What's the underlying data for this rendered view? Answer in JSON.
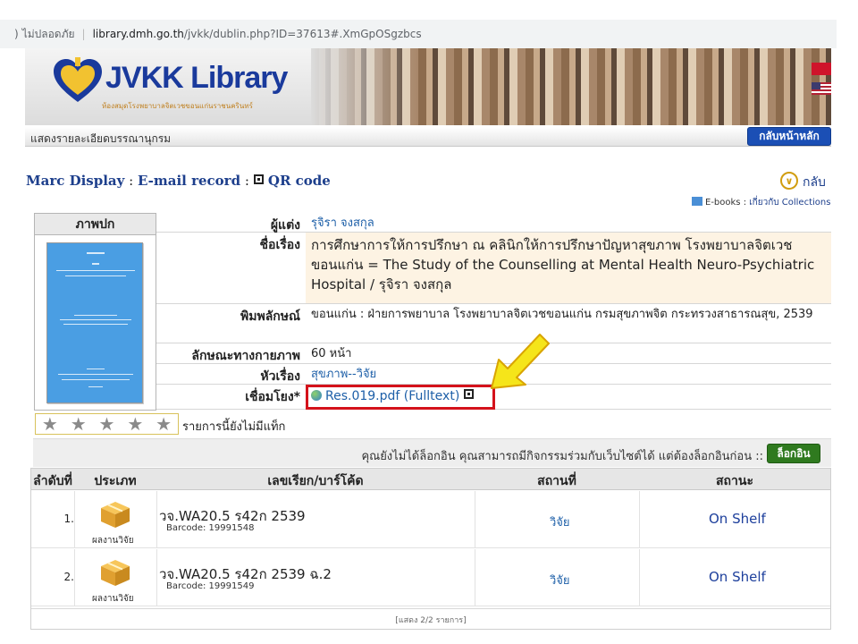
{
  "browser": {
    "security_label": "ไม่ปลอดภัย",
    "url_host": "library.dmh.go.th",
    "url_path": "/jvkk/dublin.php?ID=37613#.XmGpOSgzbcs"
  },
  "banner": {
    "logo_text": "JVKK Library",
    "logo_subtitle": "ห้องสมุดโรงพยาบาลจิตเวชขอนแก่นราชนครินทร์"
  },
  "subheader": {
    "title": "แสดงรายละเอียดบรรณานุกรม",
    "home_button": "กลับหน้าหลัก"
  },
  "marc_line": {
    "marc": "Marc Display",
    "sep1": " : ",
    "email": "E-mail record",
    "sep2": " : ",
    "qr": "QR code"
  },
  "back_label": "กลับ",
  "ebooks": {
    "label": "E-books : ",
    "link": "เกี่ยวกับ Collections"
  },
  "cover": {
    "heading": "ภาพปก"
  },
  "record": {
    "author_label": "ผู้แต่ง",
    "author": "รุจิรา จงสกุล",
    "title_label": "ชื่อเรื่อง",
    "title": "การศึกษาการให้การปรึกษา ณ คลินิกให้การปรึกษาปัญหาสุขภาพ โรงพยาบาลจิตเวชขอนแก่น = The Study of the Counselling at Mental Health Neuro-Psychiatric Hospital / รุจิรา จงสกุล",
    "publish_label": "พิมพลักษณ์",
    "publish": "ขอนแก่น : ฝ่ายการพยาบาล โรงพยาบาลจิตเวชขอนแก่น กรมสุขภาพจิต กระทรวงสาธารณสุข, 2539",
    "physical_label": "ลักษณะทางกายภาพ",
    "physical": "60 หน้า",
    "subject_label": "หัวเรื่อง",
    "subject": "สุขภาพ--วิจัย",
    "link_label": "เชื่อมโยง*",
    "link": "Res.019.pdf (Fulltext)"
  },
  "rating": {
    "text": "รายการนี้ยังไม่มีแท็ก",
    "stars": 0
  },
  "login_bar": {
    "text": "คุณยังไม่ได้ล็อกอิน คุณสามารถมีกิจกรรมร่วมกับเว็บไซต์ได้ แต่ต้องล็อกอินก่อน ::",
    "button": "ล็อกอิน"
  },
  "holdings": {
    "headers": [
      "ลำดับที่",
      "ประเภท",
      "เลขเรียก/บาร์โค้ด",
      "สถานที่",
      "สถานะ"
    ],
    "rows": [
      {
        "num": "1.",
        "type": "ผลงานวิจัย",
        "callno": "วจ.WA20.5 ร42ก 2539",
        "barcode": "Barcode: 19991548",
        "location": "วิจัย",
        "status": "On Shelf"
      },
      {
        "num": "2.",
        "type": "ผลงานวิจัย",
        "callno": "วจ.WA20.5 ร42ก 2539 ฉ.2",
        "barcode": "Barcode: 19991549",
        "location": "วิจัย",
        "status": "On Shelf"
      }
    ],
    "footer": "[แสดง 2/2 รายการ]"
  },
  "colors": {
    "link_blue": "#1d5fa8",
    "home_button": "#1b4fb5",
    "login_button": "#2f7a1f",
    "highlight_red": "#d4121b",
    "arrow_yellow": "#f5e51a"
  }
}
